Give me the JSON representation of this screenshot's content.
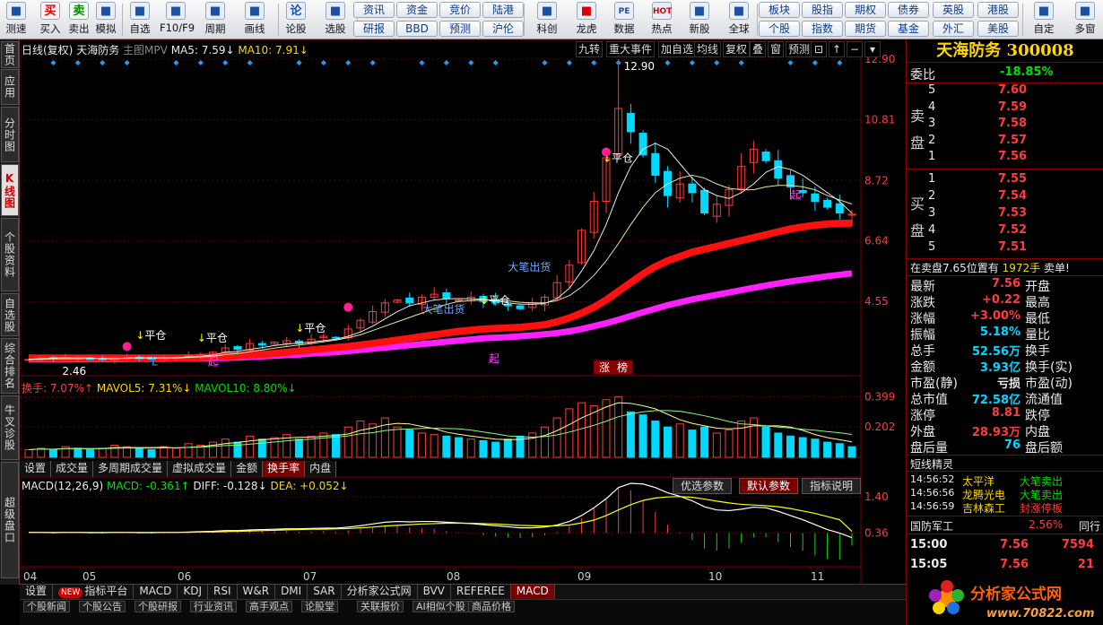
{
  "colors": {
    "up": "#ff3b3b",
    "down": "#00d8ff",
    "ma_red": "#ff1010",
    "ma_magenta": "#ff20ff",
    "ma5": "#e8e8e8",
    "ma10": "#e8e89a",
    "accent": "#8a0000"
  },
  "toolbar": [
    {
      "label": "测速",
      "icon": "speed-icon"
    },
    {
      "label": "买入",
      "icon": "buy-icon",
      "glyph": "买"
    },
    {
      "label": "卖出",
      "icon": "sell-icon",
      "glyph": "卖"
    },
    {
      "label": "模拟",
      "icon": "hammer-icon"
    },
    {
      "label": "自选",
      "icon": "star-icon"
    },
    {
      "label": "F10/F9",
      "icon": "f10-icon"
    },
    {
      "label": "周期",
      "icon": "clock-icon"
    },
    {
      "label": "画线",
      "icon": "pen-icon"
    },
    {
      "label": "论股",
      "icon": "lun-icon",
      "glyph": "论"
    },
    {
      "label": "选股",
      "icon": "magnifier-icon"
    },
    {
      "label": "科创",
      "icon": "chart-icon"
    },
    {
      "label": "龙虎",
      "icon": "dragon-icon"
    },
    {
      "label": "数据",
      "icon": "pe-icon",
      "glyph": "PE"
    },
    {
      "label": "热点",
      "icon": "hot-icon",
      "glyph": "HOT"
    },
    {
      "label": "新股",
      "icon": "newstock-icon"
    },
    {
      "label": "全球",
      "icon": "globe-icon"
    },
    {
      "label": "自定",
      "icon": "custom-icon"
    },
    {
      "label": "多窗",
      "icon": "multiwindow-icon"
    }
  ],
  "toolbar_pills": [
    [
      "资讯",
      "研报"
    ],
    [
      "资金",
      "BBD"
    ],
    [
      "竞价",
      "预测"
    ],
    [
      "陆港",
      "沪伦"
    ],
    [
      "板块",
      "个股"
    ],
    [
      "股指",
      "指数"
    ],
    [
      "期权",
      "期货"
    ],
    [
      "债券",
      "基金"
    ],
    [
      "英股",
      "外汇"
    ],
    [
      "港股",
      "美股"
    ]
  ],
  "left_tabs": [
    {
      "label": "首页",
      "active": false
    },
    {
      "label": "应用",
      "active": false
    },
    {
      "label": "分时图",
      "active": false
    },
    {
      "label": "K线图",
      "active": true
    },
    {
      "label": "个股资料",
      "active": false
    },
    {
      "label": "自选股",
      "active": false
    },
    {
      "label": "综合排名",
      "active": false
    },
    {
      "label": "牛叉诊股",
      "active": false
    },
    {
      "label": "超级盘口",
      "active": false
    }
  ],
  "chart_header": {
    "period": "日线(复权)",
    "name": "天海防务",
    "indicator": "主图MPV",
    "ma5": "MA5: 7.59↓",
    "ma10": "MA10: 7.91↓"
  },
  "top_buttons": [
    "九转",
    "重大事件",
    "加自选",
    "均线",
    "复权",
    "叠",
    "窗",
    "预测"
  ],
  "annotations": {
    "high": "12.90",
    "low": "2.46",
    "close_position": "平仓",
    "big_sell": "大笔出货",
    "start": "起",
    "limit_up_label": "涨",
    "limit_up_label2": "榜",
    "trend_l": "L"
  },
  "volume_header": {
    "turnover": "换手: 7.07%↑",
    "mavol5": "MAVOL5: 7.31%↓",
    "mavol10": "MAVOL10: 8.80%↓"
  },
  "sub_tabs": [
    {
      "label": "设置",
      "active": false
    },
    {
      "label": "成交量",
      "active": false
    },
    {
      "label": "多周期成交量",
      "active": false
    },
    {
      "label": "虚拟成交量",
      "active": false
    },
    {
      "label": "金额",
      "active": false
    },
    {
      "label": "换手率",
      "active": true
    },
    {
      "label": "内盘",
      "active": false
    }
  ],
  "macd_header": {
    "title": "MACD(12,26,9)",
    "macd": "MACD: -0.361↑",
    "diff": "DIFF: -0.128↓",
    "dea": "DEA: +0.052↓"
  },
  "param_tabs": [
    {
      "label": "优选参数",
      "active": false
    },
    {
      "label": "默认参数",
      "active": true
    },
    {
      "label": "指标说明",
      "active": false
    }
  ],
  "bottom_tabs": [
    {
      "label": "设置",
      "active": false,
      "new": false
    },
    {
      "label": "指标平台",
      "active": false,
      "new": true
    },
    {
      "label": "MACD",
      "active": false
    },
    {
      "label": "KDJ",
      "active": false
    },
    {
      "label": "RSI",
      "active": false
    },
    {
      "label": "W&R",
      "active": false
    },
    {
      "label": "DMI",
      "active": false
    },
    {
      "label": "SAR",
      "active": false
    },
    {
      "label": "分析家公式网",
      "active": false
    },
    {
      "label": "BVV",
      "active": false
    },
    {
      "label": "REFEREE",
      "active": false
    },
    {
      "label": "MACD",
      "active": true
    }
  ],
  "ticker_cells": [
    "个股新闻",
    "个股公告",
    "个股研报",
    "行业资讯",
    "高手观点",
    "论股堂",
    "关联报价",
    "AI相似个股",
    "商品价格"
  ],
  "right_panel": {
    "title": "天海防务 300008",
    "webi_label": "委比",
    "webi_value": "-18.85%",
    "sell_label": [
      "卖",
      "盘"
    ],
    "buy_label": [
      "买",
      "盘"
    ],
    "sell_orders": [
      {
        "level": "5",
        "price": "7.60"
      },
      {
        "level": "4",
        "price": "7.59"
      },
      {
        "level": "3",
        "price": "7.58"
      },
      {
        "level": "2",
        "price": "7.57"
      },
      {
        "level": "1",
        "price": "7.56"
      }
    ],
    "buy_orders": [
      {
        "level": "1",
        "price": "7.55"
      },
      {
        "level": "2",
        "price": "7.54"
      },
      {
        "level": "3",
        "price": "7.53"
      },
      {
        "level": "4",
        "price": "7.52"
      },
      {
        "level": "5",
        "price": "7.51"
      }
    ],
    "notice": {
      "prefix": "在卖盘7.65位置有",
      "amount": "1972手",
      "suffix": "卖单!"
    },
    "quote_rows": [
      {
        "l": "最新",
        "v": "7.56",
        "vc": "red",
        "r": "开盘"
      },
      {
        "l": "涨跌",
        "v": "+0.22",
        "vc": "red",
        "r": "最高"
      },
      {
        "l": "涨幅",
        "v": "+3.00%",
        "vc": "red",
        "r": "最低"
      },
      {
        "l": "振幅",
        "v": "5.18%",
        "vc": "cyan",
        "r": "量比"
      },
      {
        "l": "总手",
        "v": "52.56万",
        "vc": "cyan",
        "r": "换手"
      },
      {
        "l": "金额",
        "v": "3.93亿",
        "vc": "cyan",
        "r": "换手(实)"
      },
      {
        "l": "市盈(静)",
        "v": "亏损",
        "vc": "white",
        "r": "市盈(动)"
      },
      {
        "l": "总市值",
        "v": "72.58亿",
        "vc": "cyan",
        "r": "流通值"
      },
      {
        "l": "涨停",
        "v": "8.81",
        "vc": "red",
        "r": "跌停"
      },
      {
        "l": "外盘",
        "v": "28.93万",
        "vc": "red",
        "r": "内盘"
      },
      {
        "l": "盘后量",
        "v": "76",
        "vc": "cyan",
        "r": "盘后额"
      }
    ],
    "elves_title": "短线精灵",
    "elves": [
      {
        "time": "14:56:52",
        "stock": "太平洋",
        "event": "大笔卖出"
      },
      {
        "time": "14:56:56",
        "stock": "龙腾光电",
        "event": "大笔卖出"
      },
      {
        "time": "14:56:59",
        "stock": "吉林森工",
        "event": "封涨停板"
      }
    ],
    "sector": {
      "name": "国防军工",
      "change": "2.56%",
      "tail": "同行"
    },
    "ticks": [
      {
        "time": "15:00",
        "price": "7.56",
        "vol": "7594"
      },
      {
        "time": "15:05",
        "price": "7.56",
        "vol": "21"
      }
    ]
  },
  "logo": {
    "text": "分析家公式网",
    "url": "www.70822.com"
  },
  "chart_data": [
    {
      "type": "line",
      "title": "日线(复权) 天海防务",
      "x_ticks": [
        "04",
        "05",
        "06",
        "07",
        "08",
        "09",
        "10",
        "11"
      ],
      "y_ticks": [
        "12.90",
        "10.81",
        "8.72",
        "6.64",
        "4.55"
      ],
      "ylim": [
        2.3,
        12.9
      ],
      "series": [
        {
          "name": "close",
          "values": [
            2.55,
            2.6,
            2.58,
            2.62,
            2.6,
            2.55,
            2.57,
            2.6,
            2.62,
            2.58,
            2.56,
            2.6,
            2.62,
            2.7,
            2.72,
            2.8,
            2.95,
            2.9,
            3.1,
            3.05,
            3.15,
            3.2,
            3.1,
            3.25,
            3.35,
            3.3,
            3.6,
            3.9,
            4.2,
            4.5,
            4.6,
            4.5,
            4.7,
            4.8,
            4.65,
            4.6,
            4.7,
            4.55,
            4.5,
            4.4,
            4.3,
            4.5,
            4.7,
            5.2,
            5.8,
            7.0,
            8.0,
            9.5,
            11.2,
            10.4,
            9.6,
            8.9,
            8.2,
            8.6,
            8.3,
            7.6,
            7.9,
            8.4,
            9.2,
            9.8,
            9.4,
            8.8,
            8.5,
            8.3,
            8.0,
            7.8,
            7.6,
            7.56
          ]
        },
        {
          "name": "MA5",
          "values": [
            2.55,
            2.58,
            2.6,
            2.6,
            2.6,
            2.6,
            2.58,
            2.58,
            2.6,
            2.6,
            2.6,
            2.6,
            2.6,
            2.64,
            2.66,
            2.7,
            2.8,
            2.83,
            2.9,
            2.96,
            3.03,
            3.08,
            3.12,
            3.15,
            3.2,
            3.25,
            3.35,
            3.5,
            3.7,
            3.95,
            4.2,
            4.4,
            4.5,
            4.6,
            4.64,
            4.65,
            4.64,
            4.62,
            4.58,
            4.5,
            4.46,
            4.45,
            4.48,
            4.65,
            5.0,
            5.6,
            6.3,
            7.2,
            8.3,
            9.2,
            9.8,
            10.0,
            9.8,
            9.3,
            8.8,
            8.4,
            8.2,
            8.1,
            8.3,
            8.6,
            9.0,
            9.2,
            9.1,
            8.9,
            8.6,
            8.3,
            8.0,
            7.59
          ]
        },
        {
          "name": "MA10",
          "values": [
            2.55,
            2.56,
            2.57,
            2.58,
            2.58,
            2.59,
            2.59,
            2.59,
            2.59,
            2.6,
            2.6,
            2.6,
            2.6,
            2.62,
            2.64,
            2.66,
            2.72,
            2.76,
            2.82,
            2.88,
            2.94,
            3.0,
            3.05,
            3.1,
            3.16,
            3.22,
            3.3,
            3.4,
            3.55,
            3.7,
            3.85,
            4.0,
            4.15,
            4.3,
            4.45,
            4.55,
            4.58,
            4.6,
            4.6,
            4.57,
            4.52,
            4.5,
            4.5,
            4.58,
            4.75,
            5.05,
            5.45,
            5.95,
            6.55,
            7.2,
            7.8,
            8.3,
            8.6,
            8.8,
            8.9,
            8.8,
            8.6,
            8.45,
            8.4,
            8.4,
            8.5,
            8.55,
            8.55,
            8.5,
            8.4,
            8.2,
            8.05,
            7.91
          ]
        },
        {
          "name": "MPV-red",
          "values": [
            2.6,
            2.6,
            2.6,
            2.6,
            2.6,
            2.6,
            2.6,
            2.6,
            2.6,
            2.6,
            2.6,
            2.6,
            2.6,
            2.6,
            2.62,
            2.64,
            2.66,
            2.68,
            2.7,
            2.73,
            2.76,
            2.8,
            2.84,
            2.88,
            2.92,
            2.96,
            3.0,
            3.05,
            3.1,
            3.16,
            3.22,
            3.28,
            3.34,
            3.4,
            3.46,
            3.52,
            3.56,
            3.6,
            3.62,
            3.64,
            3.66,
            3.7,
            3.75,
            3.85,
            3.98,
            4.15,
            4.35,
            4.6,
            4.9,
            5.2,
            5.5,
            5.75,
            5.95,
            6.1,
            6.25,
            6.35,
            6.45,
            6.55,
            6.65,
            6.75,
            6.85,
            6.95,
            7.05,
            7.12,
            7.18,
            7.22,
            7.24,
            7.25
          ]
        },
        {
          "name": "MPV-magenta",
          "values": [
            2.55,
            2.55,
            2.55,
            2.55,
            2.56,
            2.56,
            2.56,
            2.56,
            2.57,
            2.57,
            2.57,
            2.57,
            2.58,
            2.58,
            2.58,
            2.6,
            2.6,
            2.62,
            2.64,
            2.66,
            2.68,
            2.7,
            2.72,
            2.75,
            2.78,
            2.8,
            2.84,
            2.88,
            2.92,
            2.96,
            3.0,
            3.04,
            3.08,
            3.12,
            3.16,
            3.2,
            3.24,
            3.28,
            3.3,
            3.32,
            3.35,
            3.38,
            3.42,
            3.46,
            3.52,
            3.6,
            3.7,
            3.8,
            3.92,
            4.05,
            4.18,
            4.3,
            4.42,
            4.52,
            4.62,
            4.7,
            4.78,
            4.86,
            4.94,
            5.02,
            5.1,
            5.17,
            5.24,
            5.3,
            5.36,
            5.42,
            5.47,
            5.52
          ]
        }
      ]
    },
    {
      "type": "bar",
      "title": "换手",
      "y_ticks": [
        "0.399",
        "0.202"
      ],
      "ylim": [
        0,
        0.42
      ],
      "series": [
        {
          "name": "换手",
          "values": [
            0.05,
            0.06,
            0.05,
            0.07,
            0.06,
            0.05,
            0.06,
            0.08,
            0.07,
            0.06,
            0.05,
            0.07,
            0.06,
            0.09,
            0.08,
            0.1,
            0.12,
            0.1,
            0.14,
            0.12,
            0.13,
            0.15,
            0.12,
            0.14,
            0.16,
            0.15,
            0.2,
            0.24,
            0.22,
            0.26,
            0.2,
            0.18,
            0.16,
            0.15,
            0.14,
            0.13,
            0.12,
            0.11,
            0.1,
            0.12,
            0.14,
            0.16,
            0.2,
            0.26,
            0.32,
            0.36,
            0.34,
            0.38,
            0.4,
            0.3,
            0.28,
            0.24,
            0.2,
            0.22,
            0.18,
            0.2,
            0.16,
            0.18,
            0.24,
            0.26,
            0.2,
            0.16,
            0.14,
            0.13,
            0.12,
            0.1,
            0.09,
            0.07
          ]
        }
      ]
    },
    {
      "type": "line",
      "title": "MACD(12,26,9)",
      "y_ticks": [
        "1.40",
        "0.36"
      ],
      "ylim": [
        -0.6,
        1.6
      ],
      "series": [
        {
          "name": "DIFF",
          "values": [
            0.02,
            0.02,
            0.01,
            0.02,
            0.02,
            0.01,
            0.01,
            0.02,
            0.02,
            0.01,
            0.01,
            0.02,
            0.02,
            0.03,
            0.04,
            0.05,
            0.07,
            0.07,
            0.09,
            0.1,
            0.11,
            0.12,
            0.12,
            0.13,
            0.14,
            0.14,
            0.17,
            0.21,
            0.26,
            0.31,
            0.33,
            0.32,
            0.33,
            0.33,
            0.31,
            0.29,
            0.27,
            0.24,
            0.21,
            0.18,
            0.15,
            0.15,
            0.17,
            0.23,
            0.33,
            0.5,
            0.72,
            0.98,
            1.3,
            1.42,
            1.4,
            1.3,
            1.15,
            1.05,
            0.92,
            0.75,
            0.66,
            0.64,
            0.68,
            0.74,
            0.72,
            0.62,
            0.5,
            0.38,
            0.24,
            0.1,
            0.0,
            -0.13
          ]
        },
        {
          "name": "DEA",
          "values": [
            0.02,
            0.02,
            0.02,
            0.02,
            0.02,
            0.02,
            0.02,
            0.02,
            0.02,
            0.02,
            0.02,
            0.02,
            0.02,
            0.02,
            0.03,
            0.03,
            0.04,
            0.05,
            0.06,
            0.07,
            0.08,
            0.09,
            0.1,
            0.11,
            0.11,
            0.12,
            0.13,
            0.15,
            0.17,
            0.2,
            0.22,
            0.24,
            0.26,
            0.27,
            0.28,
            0.28,
            0.28,
            0.27,
            0.26,
            0.24,
            0.22,
            0.21,
            0.2,
            0.21,
            0.23,
            0.29,
            0.37,
            0.5,
            0.66,
            0.81,
            0.93,
            1.0,
            1.03,
            1.04,
            1.02,
            0.97,
            0.91,
            0.86,
            0.82,
            0.8,
            0.78,
            0.75,
            0.7,
            0.63,
            0.56,
            0.47,
            0.38,
            0.05
          ]
        }
      ]
    }
  ]
}
